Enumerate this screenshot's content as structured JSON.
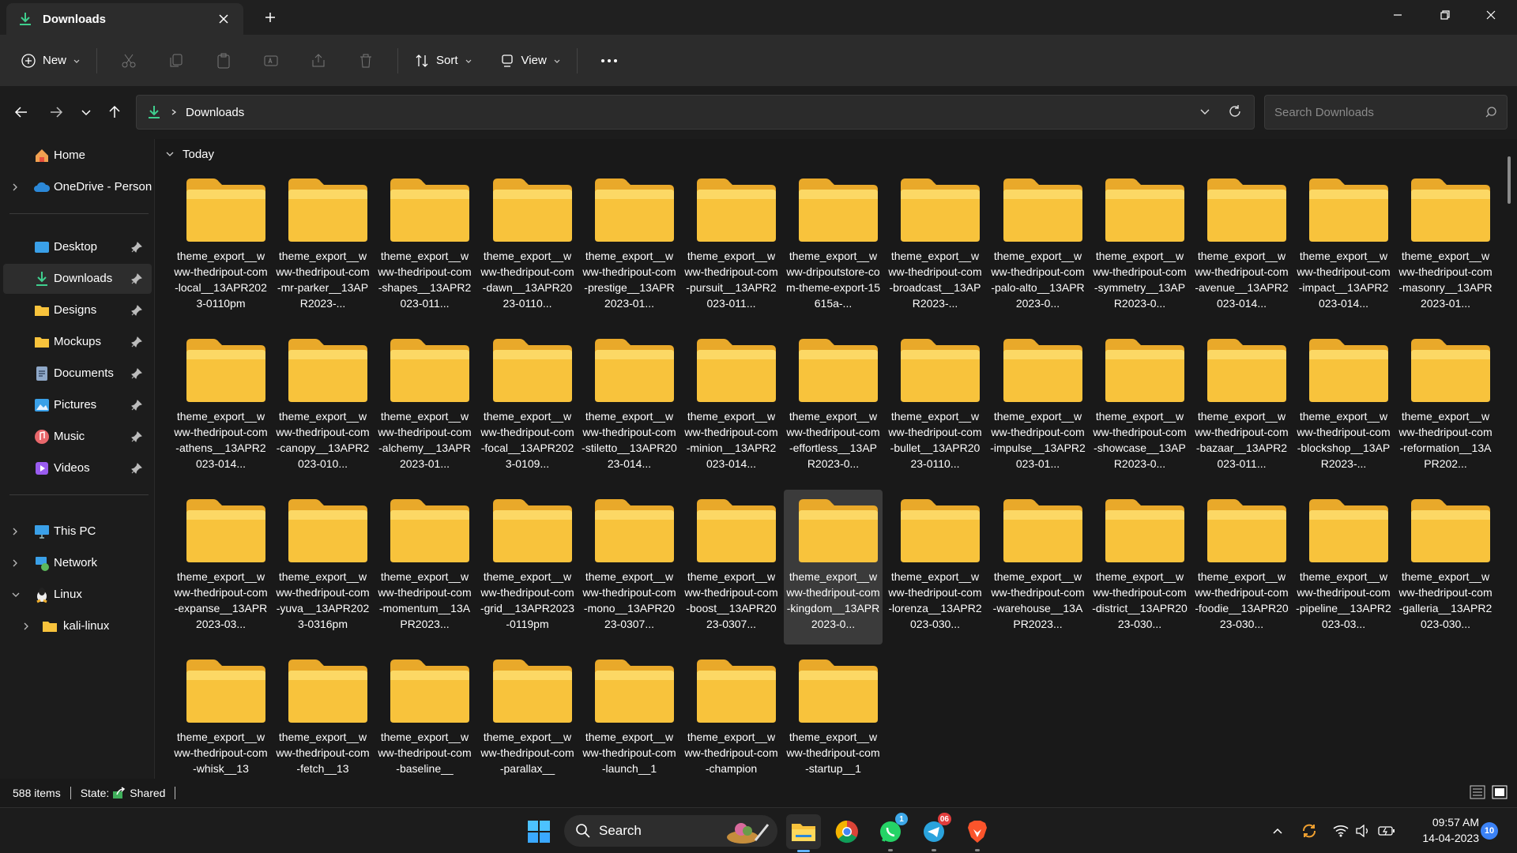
{
  "window": {
    "tab_title": "Downloads",
    "new_tab_symbol": "+",
    "minimize_symbol": "—",
    "close_symbol": "✕"
  },
  "toolbar": {
    "new_label": "New",
    "sort_label": "Sort",
    "view_label": "View",
    "more_symbol": "•••"
  },
  "address": {
    "path": "Downloads",
    "search_placeholder": "Search Downloads"
  },
  "sidebar": {
    "items": [
      {
        "label": "Home",
        "icon": "home-icon",
        "pinned": false
      },
      {
        "label": "OneDrive - Persona",
        "icon": "cloud-icon",
        "pinned": false
      },
      {
        "label": "Desktop",
        "icon": "desktop-icon",
        "pinned": true
      },
      {
        "label": "Downloads",
        "icon": "download-icon",
        "pinned": true
      },
      {
        "label": "Designs",
        "icon": "folder-icon",
        "pinned": true
      },
      {
        "label": "Mockups",
        "icon": "folder-icon",
        "pinned": true
      },
      {
        "label": "Documents",
        "icon": "documents-icon",
        "pinned": true
      },
      {
        "label": "Pictures",
        "icon": "pictures-icon",
        "pinned": true
      },
      {
        "label": "Music",
        "icon": "music-icon",
        "pinned": true
      },
      {
        "label": "Videos",
        "icon": "videos-icon",
        "pinned": true
      },
      {
        "label": "This PC",
        "icon": "pc-icon",
        "pinned": false
      },
      {
        "label": "Network",
        "icon": "network-icon",
        "pinned": false
      },
      {
        "label": "Linux",
        "icon": "linux-icon",
        "pinned": false
      },
      {
        "label": "kali-linux",
        "icon": "folder-icon",
        "pinned": false
      }
    ]
  },
  "content": {
    "group_label": "Today",
    "files": [
      "theme_export__www-thedripout-com-local__13APR2023-0110pm",
      "theme_export__www-thedripout-com-mr-parker__13APR2023-...",
      "theme_export__www-thedripout-com-shapes__13APR2023-011...",
      "theme_export__www-thedripout-com-dawn__13APR2023-0110...",
      "theme_export__www-thedripout-com-prestige__13APR2023-01...",
      "theme_export__www-thedripout-com-pursuit__13APR2023-011...",
      "theme_export__www-dripoutstore-com-theme-export-15615a-...",
      "theme_export__www-thedripout-com-broadcast__13APR2023-...",
      "theme_export__www-thedripout-com-palo-alto__13APR2023-0...",
      "theme_export__www-thedripout-com-symmetry__13APR2023-0...",
      "theme_export__www-thedripout-com-avenue__13APR2023-014...",
      "theme_export__www-thedripout-com-impact__13APR2023-014...",
      "theme_export__www-thedripout-com-masonry__13APR2023-01...",
      "theme_export__www-thedripout-com-athens__13APR2023-014...",
      "theme_export__www-thedripout-com-canopy__13APR2023-010...",
      "theme_export__www-thedripout-com-alchemy__13APR2023-01...",
      "theme_export__www-thedripout-com-focal__13APR2023-0109...",
      "theme_export__www-thedripout-com-stiletto__13APR2023-014...",
      "theme_export__www-thedripout-com-minion__13APR2023-014...",
      "theme_export__www-thedripout-com-effortless__13APR2023-0...",
      "theme_export__www-thedripout-com-bullet__13APR2023-0110...",
      "theme_export__www-thedripout-com-impulse__13APR2023-01...",
      "theme_export__www-thedripout-com-showcase__13APR2023-0...",
      "theme_export__www-thedripout-com-bazaar__13APR2023-011...",
      "theme_export__www-thedripout-com-blockshop__13APR2023-...",
      "theme_export__www-thedripout-com-reformation__13APR202...",
      "theme_export__www-thedripout-com-expanse__13APR2023-03...",
      "theme_export__www-thedripout-com-yuva__13APR2023-0316pm",
      "theme_export__www-thedripout-com-momentum__13APR2023...",
      "theme_export__www-thedripout-com-grid__13APR2023-0119pm",
      "theme_export__www-thedripout-com-mono__13APR2023-0307...",
      "theme_export__www-thedripout-com-boost__13APR2023-0307...",
      "theme_export__www-thedripout-com-kingdom__13APR2023-0...",
      "theme_export__www-thedripout-com-lorenza__13APR2023-030...",
      "theme_export__www-thedripout-com-warehouse__13APR2023...",
      "theme_export__www-thedripout-com-district__13APR2023-030...",
      "theme_export__www-thedripout-com-foodie__13APR2023-030...",
      "theme_export__www-thedripout-com-pipeline__13APR2023-03...",
      "theme_export__www-thedripout-com-galleria__13APR2023-030...",
      "theme_export__www-thedripout-com-whisk__13",
      "theme_export__www-thedripout-com-fetch__13",
      "theme_export__www-thedripout-com-baseline__",
      "theme_export__www-thedripout-com-parallax__",
      "theme_export__www-thedripout-com-launch__1",
      "theme_export__www-thedripout-com-champion",
      "theme_export__www-thedripout-com-startup__1"
    ],
    "selected_index": 32
  },
  "status": {
    "item_count": "588 items",
    "state_label": "State:",
    "state_value": "Shared"
  },
  "taskbar": {
    "search_label": "Search",
    "whatsapp_badge": "1",
    "telegram_badge": "06",
    "time": "09:57 AM",
    "date": "14-04-2023",
    "notification_count": "10"
  },
  "colors": {
    "accent": "#61b3ff",
    "folder": "#f8c33c",
    "download_green": "#3fcf8e"
  }
}
